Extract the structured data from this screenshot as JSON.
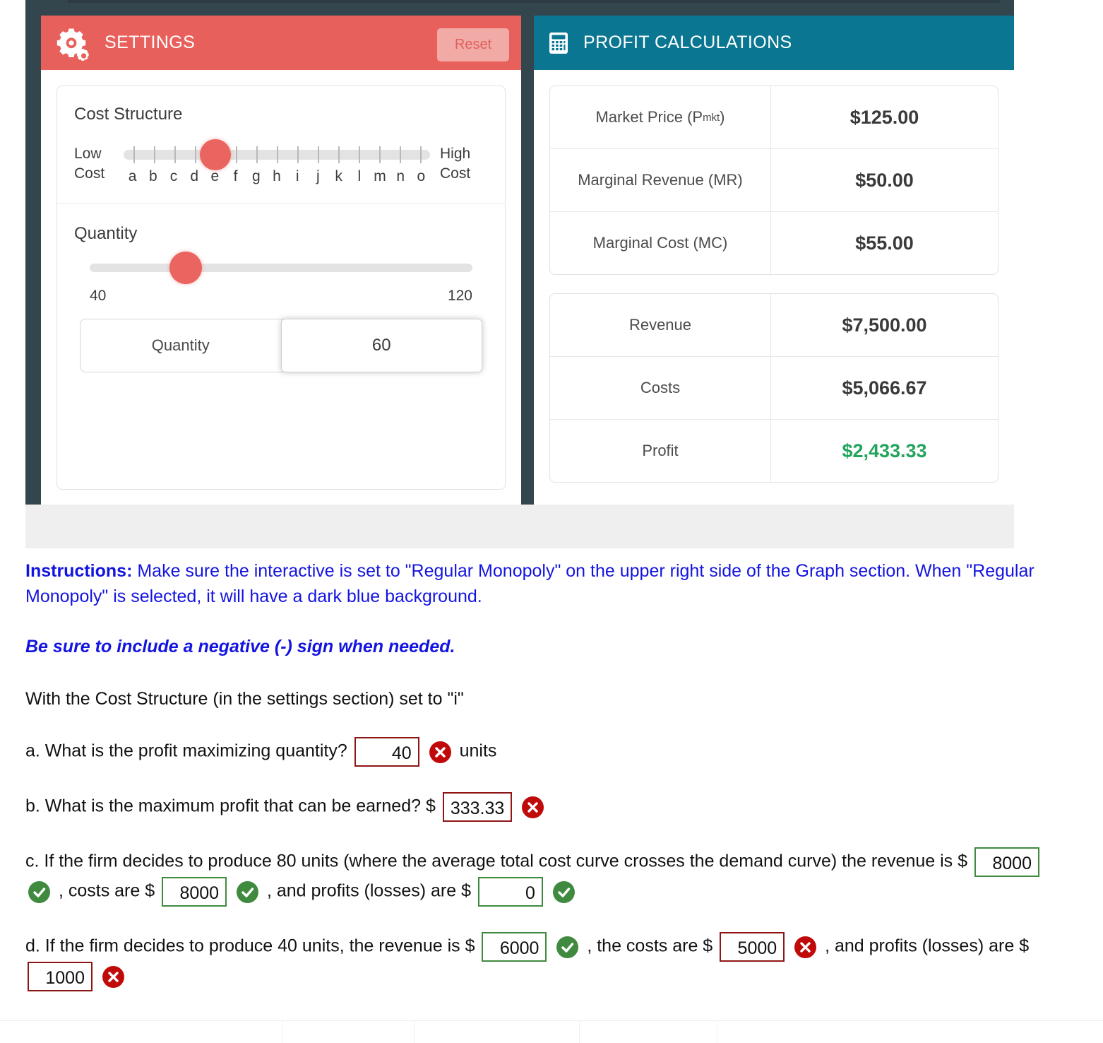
{
  "settings_panel": {
    "title": "SETTINGS",
    "icon": "gear-icon",
    "reset_label": "Reset",
    "header_color": "#e8605c",
    "cost_structure": {
      "label": "Cost Structure",
      "low_label": "Low\nCost",
      "low_line1": "Low",
      "low_line2": "Cost",
      "high_line1": "High",
      "high_line2": "Cost",
      "ticks": [
        "a",
        "b",
        "c",
        "d",
        "e",
        "f",
        "g",
        "h",
        "i",
        "j",
        "k",
        "l",
        "m",
        "n",
        "o"
      ],
      "selected": "e",
      "selected_index": 4
    },
    "quantity": {
      "label": "Quantity",
      "min": "40",
      "max": "120",
      "value": "60",
      "input_label": "Quantity",
      "handle_percent": 25
    }
  },
  "profit_panel": {
    "title": "PROFIT CALCULATIONS",
    "icon": "calculator-icon",
    "header_color": "#0a7691",
    "table_top": [
      {
        "key_html": "Market Price (P<sub>mkt</sub>)",
        "key": "Market Price (Pmkt)",
        "value": "$125.00"
      },
      {
        "key_html": "Marginal Revenue (MR)",
        "key": "Marginal Revenue (MR)",
        "value": "$50.00"
      },
      {
        "key_html": "Marginal Cost (MC)",
        "key": "Marginal Cost (MC)",
        "value": "$55.00"
      }
    ],
    "table_bottom": [
      {
        "key": "Revenue",
        "value": "$7,500.00",
        "color": "default"
      },
      {
        "key": "Costs",
        "value": "$5,066.67",
        "color": "default"
      },
      {
        "key": "Profit",
        "value": "$2,433.33",
        "color": "#22a45d"
      }
    ]
  },
  "worksheet": {
    "instructions_bold": "Instructions:",
    "instructions_text": " Make sure the interactive is set to \"Regular Monopoly\" on the upper right side of the Graph section. When \"Regular Monopoly\" is selected, it will have a dark blue background.",
    "note": "Be sure to include a negative (-) sign when needed.",
    "preamble": "With the Cost Structure (in the settings section) set to \"i\"",
    "q_a": {
      "text": "a. What is the profit maximizing quantity?",
      "answer": "40",
      "status": "incorrect",
      "suffix": "units"
    },
    "q_b": {
      "text": "b. What is the maximum profit that can be earned? $",
      "answer": "333.33",
      "status": "incorrect"
    },
    "q_c": {
      "text_1": "c. If the firm decides to produce 80 units (where the average total cost curve crosses the demand curve) the revenue is $",
      "answer_1": "8000",
      "status_1": "correct",
      "text_2": ", costs are $",
      "answer_2": "8000",
      "status_2": "correct",
      "text_3": ", and profits (losses) are $",
      "answer_3": "0",
      "status_3": "correct"
    },
    "q_d": {
      "text_1": "d. If the firm decides to produce 40 units, the revenue is $",
      "answer_1": "6000",
      "status_1": "correct",
      "text_2": ", the costs are $",
      "answer_2": "5000",
      "status_2": "incorrect",
      "text_3": ", and profits (losses) are $",
      "answer_3": "1000",
      "status_3": "incorrect"
    }
  }
}
